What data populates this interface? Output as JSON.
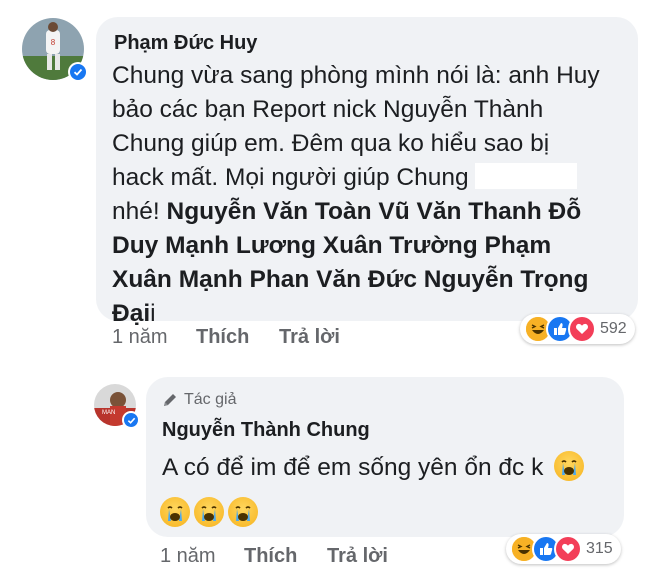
{
  "comments": [
    {
      "author": "Phạm Đức Huy",
      "verified": true,
      "text_lines": [
        "Chung vừa sang phòng mình nói là: anh Huy",
        "bảo các bạn Report nick Nguyễn Thành",
        "Chung giúp em. Đêm qua ko hiểu sao bị",
        "hack mất. Mọi người giúp Chung"
      ],
      "text_after": "nhé!",
      "mentions": [
        "Nguyễn Văn Toàn",
        "Vũ Văn Thanh",
        "Đỗ Duy Mạnh",
        "Lương Xuân Trường",
        "Phạm Xuân Mạnh",
        "Phan Văn Đức",
        "Nguyễn Trọng Đại"
      ],
      "mention_lines": [
        "Nguyễn Văn Toàn Vũ Văn Thanh Đỗ",
        "Duy Mạnh Lương Xuân Trường Phạm",
        "Xuân Mạnh Phan Văn Đức Nguyễn Trọng",
        "Đại"
      ],
      "trailing_char": "i",
      "time": "1 năm",
      "like_label": "Thích",
      "reply_label": "Trả lời",
      "reaction_count": "592",
      "reaction_icons": [
        "haha-icon",
        "like-icon",
        "love-icon"
      ]
    },
    {
      "badge": "Tác giả",
      "author": "Nguyễn Thành Chung",
      "verified": true,
      "text": "A có để im để em sống yên ổn đc k",
      "emoji": [
        "crying-face-icon",
        "crying-face-icon",
        "crying-face-icon"
      ],
      "time": "1 năm",
      "like_label": "Thích",
      "reply_label": "Trả lời",
      "reaction_count": "315",
      "reaction_icons": [
        "haha-icon",
        "like-icon",
        "love-icon"
      ]
    }
  ],
  "colors": {
    "bubble": "#f0f2f5",
    "like_blue": "#1877f2",
    "love_red": "#f33e58",
    "haha_yellow": "#f7b125",
    "meta_gray": "#65676b"
  }
}
